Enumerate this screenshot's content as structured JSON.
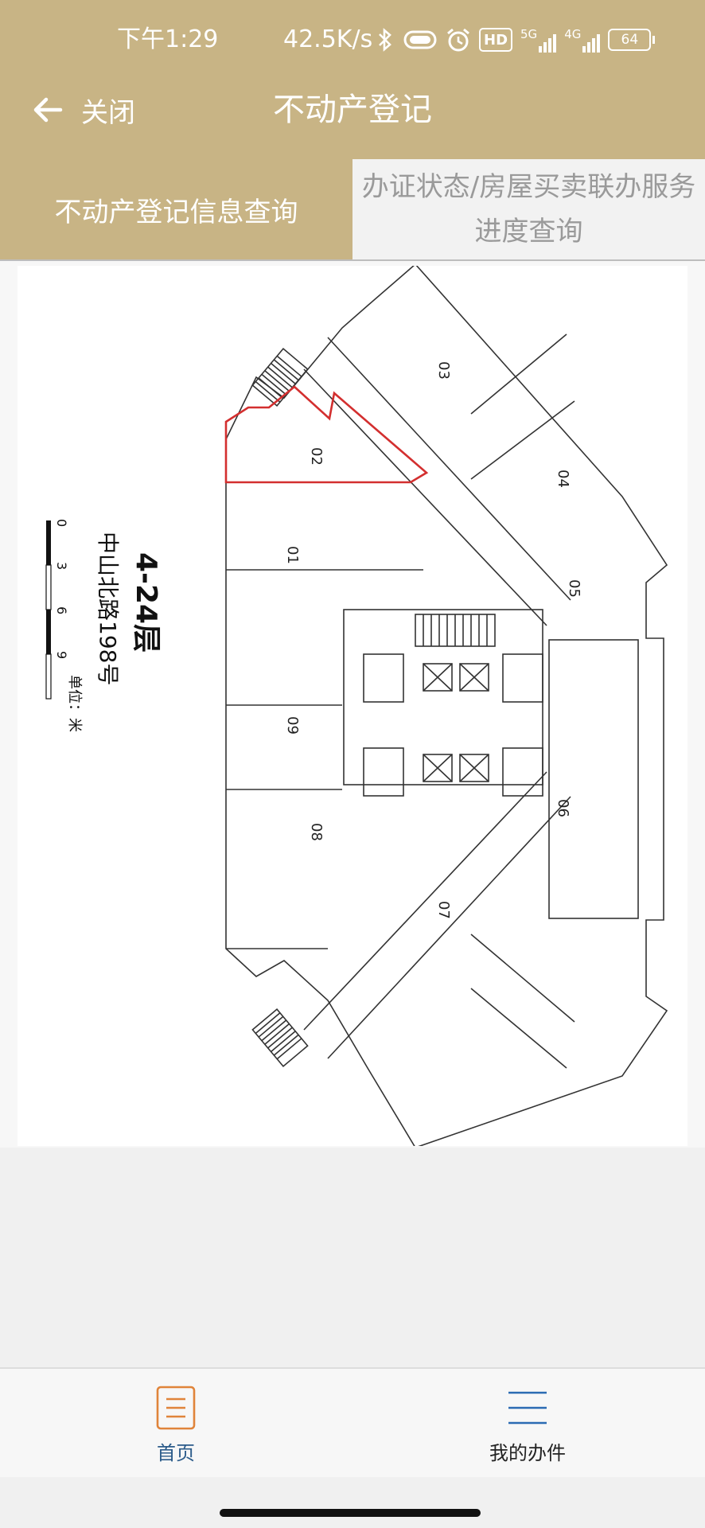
{
  "status_bar": {
    "time": "下午1:29",
    "net_speed": "42.5K/s",
    "hd_badge": "HD",
    "net_5g": "5G",
    "net_4g": "4G",
    "battery": "64",
    "icons": [
      "bluetooth-icon",
      "vibrate-icon",
      "alarm-icon",
      "hd-icon",
      "signal-5g-icon",
      "signal-4g-icon",
      "battery-icon"
    ]
  },
  "nav": {
    "back_label": "关闭",
    "title": "不动产登记"
  },
  "tabs": [
    {
      "label": "不动产登记信息查询",
      "active": true
    },
    {
      "label": "办证状态/房屋买卖联办服务进度查询",
      "active": false
    }
  ],
  "floor_plan": {
    "floor": "4-24层",
    "address": "中山北路198号",
    "unit_text": "单位：米",
    "scale_ticks": [
      "0",
      "3",
      "6",
      "9"
    ],
    "units": [
      "01",
      "02",
      "03",
      "04",
      "05",
      "06",
      "07",
      "08",
      "09"
    ],
    "highlight_color": "#d32f2f"
  },
  "bottom_nav": [
    {
      "label": "首页",
      "icon": "document-list-icon",
      "active": true
    },
    {
      "label": "我的办件",
      "icon": "menu-lines-icon",
      "active": false
    }
  ]
}
